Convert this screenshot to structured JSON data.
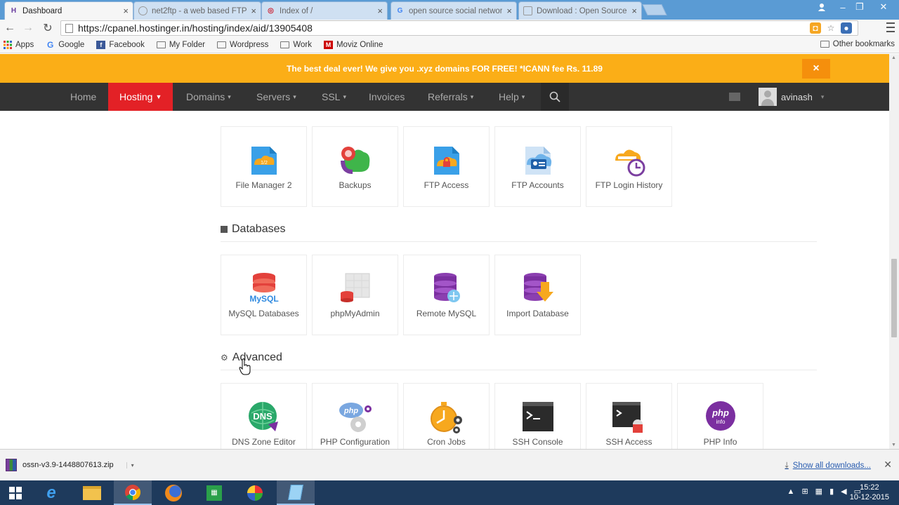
{
  "browser": {
    "tabs": [
      {
        "title": "Dashboard",
        "active": true,
        "favicon": "hostinger-icon"
      },
      {
        "title": "net2ftp - a web based FTP",
        "active": false,
        "favicon": "net2ftp-icon"
      },
      {
        "title": "Index of /",
        "active": false,
        "favicon": "index-icon"
      },
      {
        "title": "open source social network",
        "active": false,
        "favicon": "google-icon"
      },
      {
        "title": "Download : Open Source S",
        "active": false,
        "favicon": "ossn-icon"
      }
    ],
    "url": "https://cpanel.hostinger.in/hosting/index/aid/13905408",
    "bookmarks": [
      {
        "label": "Apps",
        "icon": "apps-grid-icon"
      },
      {
        "label": "Google",
        "icon": "google-icon"
      },
      {
        "label": "Facebook",
        "icon": "facebook-icon"
      },
      {
        "label": "My Folder",
        "icon": "folder-icon"
      },
      {
        "label": "Wordpress",
        "icon": "folder-icon"
      },
      {
        "label": "Work",
        "icon": "folder-icon"
      },
      {
        "label": "Moviz Online",
        "icon": "moviz-icon"
      }
    ],
    "other_bookmarks": "Other bookmarks"
  },
  "promo": {
    "text": "The best deal ever! We give you .xyz domains FOR FREE! *ICANN fee Rs. 11.89",
    "close": "×"
  },
  "nav": {
    "items": [
      {
        "label": "Home",
        "dropdown": false
      },
      {
        "label": "Hosting",
        "dropdown": true,
        "active": true
      },
      {
        "label": "Domains",
        "dropdown": true
      },
      {
        "label": "Servers",
        "dropdown": true
      },
      {
        "label": "SSL",
        "dropdown": true
      },
      {
        "label": "Invoices",
        "dropdown": false
      },
      {
        "label": "Referrals",
        "dropdown": true
      },
      {
        "label": "Help",
        "dropdown": true
      }
    ],
    "user": "avinash",
    "accent": "#e32126"
  },
  "sections": {
    "files": {
      "tiles": [
        {
          "label": "File Manager 2",
          "icon": "file-manager-icon"
        },
        {
          "label": "Backups",
          "icon": "backups-icon"
        },
        {
          "label": "FTP Access",
          "icon": "ftp-access-icon"
        },
        {
          "label": "FTP Accounts",
          "icon": "ftp-accounts-icon"
        },
        {
          "label": "FTP Login History",
          "icon": "ftp-history-icon"
        }
      ]
    },
    "databases": {
      "title": "Databases",
      "tiles": [
        {
          "label": "MySQL Databases",
          "icon": "mysql-icon"
        },
        {
          "label": "phpMyAdmin",
          "icon": "phpmyadmin-icon"
        },
        {
          "label": "Remote MySQL",
          "icon": "remote-mysql-icon"
        },
        {
          "label": "Import Database",
          "icon": "import-database-icon"
        }
      ]
    },
    "advanced": {
      "title": "Advanced",
      "tiles": [
        {
          "label": "DNS Zone Editor",
          "icon": "dns-icon"
        },
        {
          "label": "PHP Configuration",
          "icon": "php-config-icon"
        },
        {
          "label": "Cron Jobs",
          "icon": "cron-icon"
        },
        {
          "label": "SSH Console",
          "icon": "ssh-console-icon"
        },
        {
          "label": "SSH Access",
          "icon": "ssh-access-icon"
        },
        {
          "label": "PHP Info",
          "icon": "php-info-icon"
        }
      ]
    }
  },
  "downloads": {
    "file": "ossn-v3.9-1448807613.zip",
    "show_all": "Show all downloads..."
  },
  "taskbar": {
    "time": "15:22",
    "date": "10-12-2015"
  },
  "colors": {
    "promo_bg": "#fbae17",
    "nav_bg": "#333333",
    "active_nav": "#e32126"
  }
}
